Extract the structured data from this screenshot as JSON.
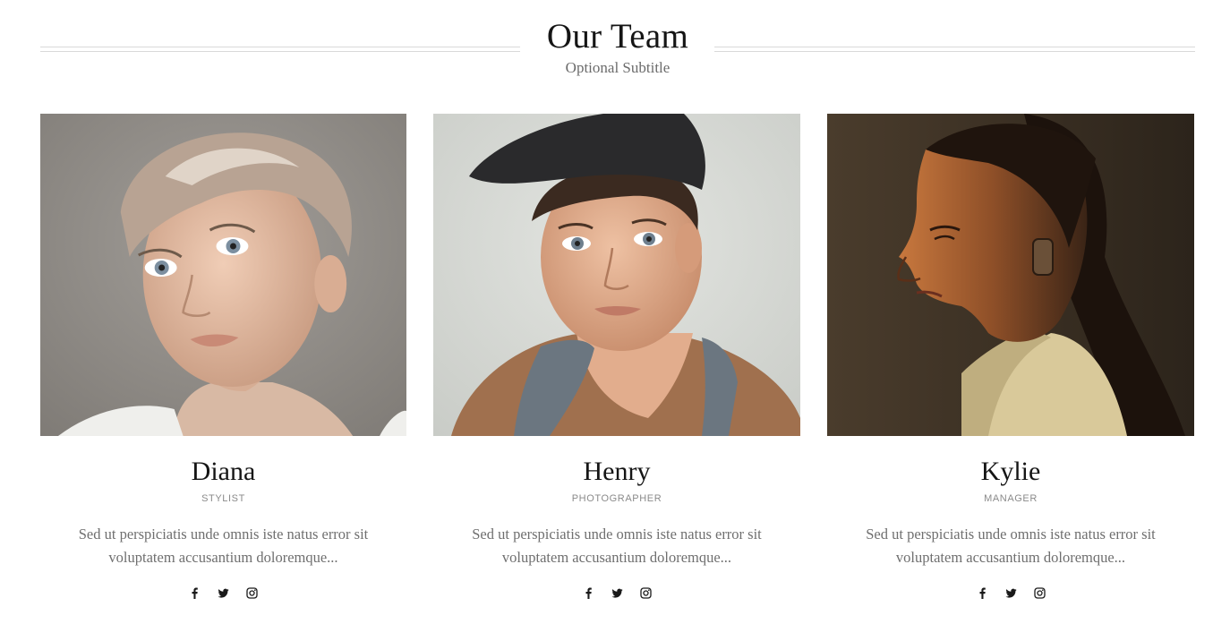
{
  "section": {
    "title": "Our Team",
    "subtitle": "Optional Subtitle"
  },
  "members": [
    {
      "name": "Diana",
      "role": "STYLIST",
      "bio": "Sed ut perspiciatis unde omnis iste natus error sit voluptatem accusantium doloremque...",
      "photo_bg": "#8f8b86"
    },
    {
      "name": "Henry",
      "role": "PHOTOGRAPHER",
      "bio": "Sed ut perspiciatis unde omnis iste natus error sit voluptatem accusantium doloremque...",
      "photo_bg": "#d8dad6"
    },
    {
      "name": "Kylie",
      "role": "MANAGER",
      "bio": "Sed ut perspiciatis unde omnis iste natus error sit voluptatem accusantium doloremque...",
      "photo_bg": "#3a2e22"
    }
  ],
  "social_icons": [
    "facebook-icon",
    "twitter-icon",
    "instagram-icon"
  ],
  "colors": {
    "title": "#151515",
    "subtitle": "#6b6b6b",
    "role": "#8a8a8a",
    "bio": "#6f6f6f",
    "divider": "#d9d9d9"
  }
}
